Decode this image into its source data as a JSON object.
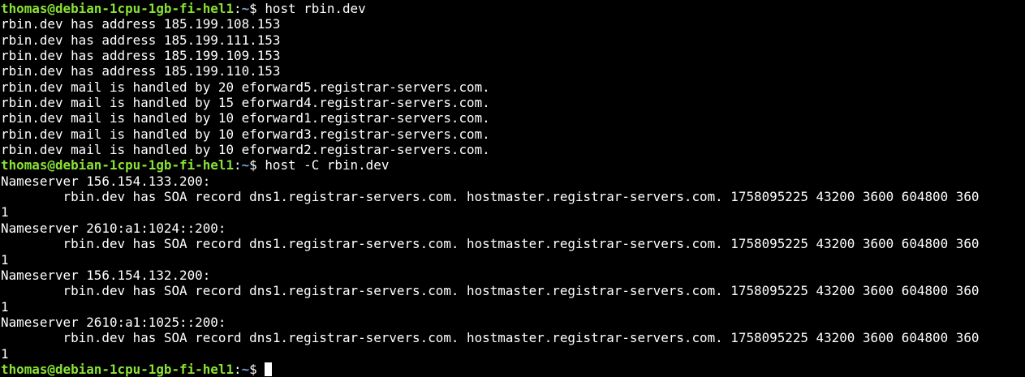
{
  "prompt": {
    "user_host": "thomas@debian-1cpu-1gb-fi-hel1",
    "separator": ":",
    "path": "~",
    "symbol": "$ "
  },
  "lines": [
    {
      "type": "prompt",
      "command": "host rbin.dev"
    },
    {
      "type": "output",
      "text": "rbin.dev has address 185.199.108.153"
    },
    {
      "type": "output",
      "text": "rbin.dev has address 185.199.111.153"
    },
    {
      "type": "output",
      "text": "rbin.dev has address 185.199.109.153"
    },
    {
      "type": "output",
      "text": "rbin.dev has address 185.199.110.153"
    },
    {
      "type": "output",
      "text": "rbin.dev mail is handled by 20 eforward5.registrar-servers.com."
    },
    {
      "type": "output",
      "text": "rbin.dev mail is handled by 15 eforward4.registrar-servers.com."
    },
    {
      "type": "output",
      "text": "rbin.dev mail is handled by 10 eforward1.registrar-servers.com."
    },
    {
      "type": "output",
      "text": "rbin.dev mail is handled by 10 eforward3.registrar-servers.com."
    },
    {
      "type": "output",
      "text": "rbin.dev mail is handled by 10 eforward2.registrar-servers.com."
    },
    {
      "type": "prompt",
      "command": "host -C rbin.dev"
    },
    {
      "type": "output",
      "text": "Nameserver 156.154.133.200:"
    },
    {
      "type": "output",
      "text": "\trbin.dev has SOA record dns1.registrar-servers.com. hostmaster.registrar-servers.com. 1758095225 43200 3600 604800 360"
    },
    {
      "type": "output",
      "text": "1"
    },
    {
      "type": "output",
      "text": "Nameserver 2610:a1:1024::200:"
    },
    {
      "type": "output",
      "text": "\trbin.dev has SOA record dns1.registrar-servers.com. hostmaster.registrar-servers.com. 1758095225 43200 3600 604800 360"
    },
    {
      "type": "output",
      "text": "1"
    },
    {
      "type": "output",
      "text": "Nameserver 156.154.132.200:"
    },
    {
      "type": "output",
      "text": "\trbin.dev has SOA record dns1.registrar-servers.com. hostmaster.registrar-servers.com. 1758095225 43200 3600 604800 360"
    },
    {
      "type": "output",
      "text": "1"
    },
    {
      "type": "output",
      "text": "Nameserver 2610:a1:1025::200:"
    },
    {
      "type": "output",
      "text": "\trbin.dev has SOA record dns1.registrar-servers.com. hostmaster.registrar-servers.com. 1758095225 43200 3600 604800 360"
    },
    {
      "type": "output",
      "text": "1"
    },
    {
      "type": "prompt",
      "command": "",
      "cursor": true
    }
  ],
  "colors": {
    "background": "#000000",
    "foreground": "#ffffff",
    "user_host": "#8ae234",
    "path": "#729fcf"
  }
}
